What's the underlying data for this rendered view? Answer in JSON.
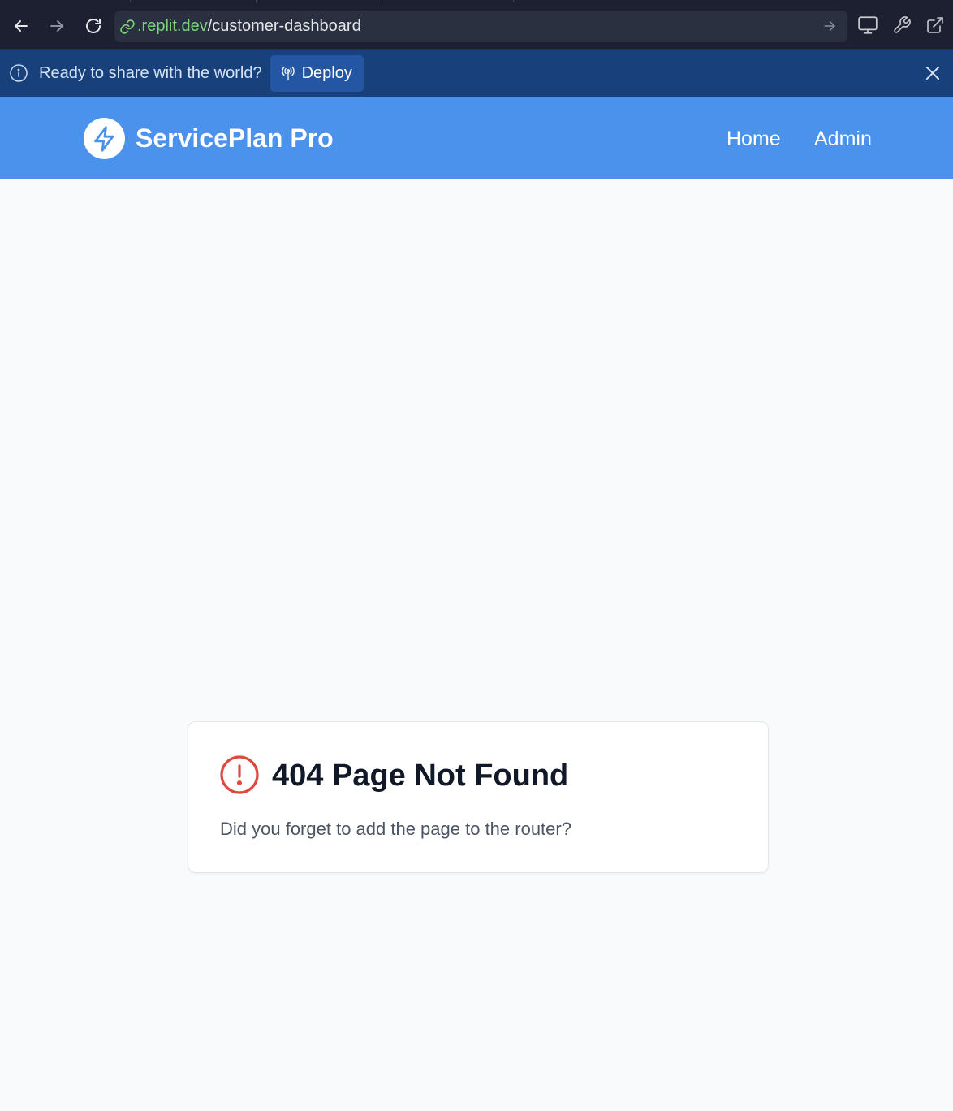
{
  "browser": {
    "url_host": ".replit.dev",
    "url_path": "/customer-dashboard",
    "back_icon": "arrow-left-icon",
    "forward_icon": "arrow-right-icon",
    "reload_icon": "reload-icon",
    "tools": [
      "monitor-icon",
      "wrench-icon",
      "external-link-icon"
    ]
  },
  "banner": {
    "message": "Ready to share with the world?",
    "deploy_label": "Deploy",
    "background": "#18417c"
  },
  "header": {
    "brand": "ServicePlan Pro",
    "nav": [
      "Home",
      "Admin"
    ],
    "background": "#4a92eb"
  },
  "not_found": {
    "title": "404 Page Not Found",
    "message": "Did you forget to add the page to the router?",
    "icon_color": "#dc4a3f"
  }
}
